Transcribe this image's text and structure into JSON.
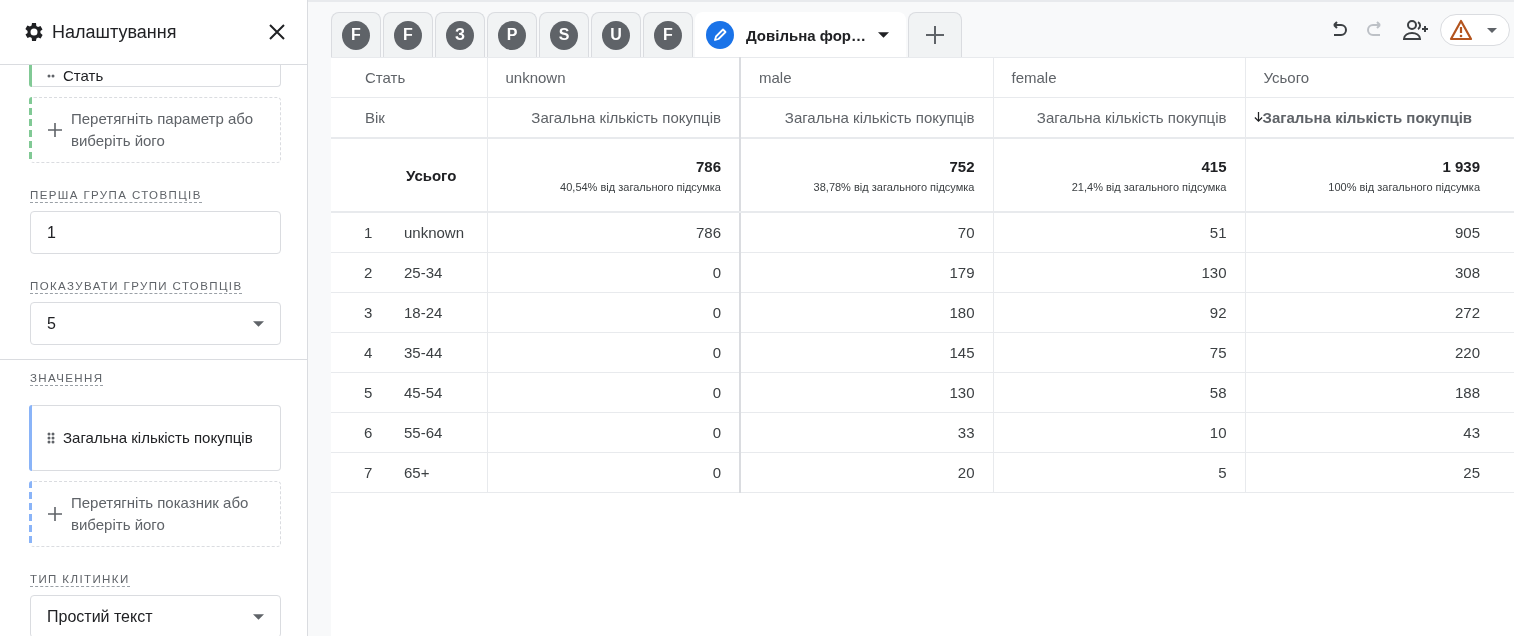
{
  "sidebar": {
    "title": "Налаштування",
    "items": [
      {
        "kind": "chip",
        "label": "Стать",
        "color": "#81c995"
      },
      {
        "kind": "drop",
        "label": "Перетягніть параметр або виберіть його",
        "color": "#81c995"
      },
      {
        "kind": "field",
        "label": "ПЕРША ГРУПА СТОВПЦІВ",
        "value": "1"
      },
      {
        "kind": "select",
        "label": "ПОКАЗУВАТИ ГРУПИ СТОВПЦІВ",
        "value": "5"
      },
      {
        "kind": "section",
        "label": "ЗНАЧЕННЯ"
      },
      {
        "kind": "chip",
        "label": "Загальна кількість покупців",
        "color": "#8ab4f8"
      },
      {
        "kind": "drop",
        "label": "Перетягніть показник або виберіть його",
        "color": "#8ab4f8"
      },
      {
        "kind": "select",
        "label": "ТИП КЛІТИНКИ",
        "value": "Простий текст"
      }
    ]
  },
  "tabs": [
    {
      "kind": "letter",
      "label": "F",
      "selected": false
    },
    {
      "kind": "letter",
      "label": "F",
      "selected": false
    },
    {
      "kind": "letter",
      "label": "З",
      "selected": false
    },
    {
      "kind": "letter",
      "label": "P",
      "selected": false
    },
    {
      "kind": "letter",
      "label": "S",
      "selected": false
    },
    {
      "kind": "letter",
      "label": "U",
      "selected": false
    },
    {
      "kind": "letter",
      "label": "F",
      "selected": false
    },
    {
      "kind": "edit",
      "label": "Довільна фор…",
      "selected": true
    }
  ],
  "toolbar": {
    "redo_disabled": true
  },
  "table": {
    "dimension_headers": [
      "Стать",
      "Вік"
    ],
    "total_label": "Усього",
    "columns": [
      {
        "group": "unknown",
        "metric": "Загальна кількість покупців",
        "sorted": false,
        "total": "786",
        "share": "40,54% від загального підсумка"
      },
      {
        "group": "male",
        "metric": "Загальна кількість покупців",
        "sorted": false,
        "total": "752",
        "share": "38,78% від загального підсумка"
      },
      {
        "group": "female",
        "metric": "Загальна кількість покупців",
        "sorted": false,
        "total": "415",
        "share": "21,4% від загального підсумка"
      },
      {
        "group": "Усього",
        "metric": "Загальна кількість покупців",
        "sorted": true,
        "total": "1 939",
        "share": "100% від загального підсумка"
      }
    ],
    "rows": [
      {
        "index": "1",
        "label": "unknown",
        "values": [
          "786",
          "70",
          "51",
          "905"
        ]
      },
      {
        "index": "2",
        "label": "25-34",
        "values": [
          "0",
          "179",
          "130",
          "308"
        ]
      },
      {
        "index": "3",
        "label": "18-24",
        "values": [
          "0",
          "180",
          "92",
          "272"
        ]
      },
      {
        "index": "4",
        "label": "35-44",
        "values": [
          "0",
          "145",
          "75",
          "220"
        ]
      },
      {
        "index": "5",
        "label": "45-54",
        "values": [
          "0",
          "130",
          "58",
          "188"
        ]
      },
      {
        "index": "6",
        "label": "55-64",
        "values": [
          "0",
          "33",
          "10",
          "43"
        ]
      },
      {
        "index": "7",
        "label": "65+",
        "values": [
          "0",
          "20",
          "5",
          "25"
        ]
      }
    ]
  }
}
